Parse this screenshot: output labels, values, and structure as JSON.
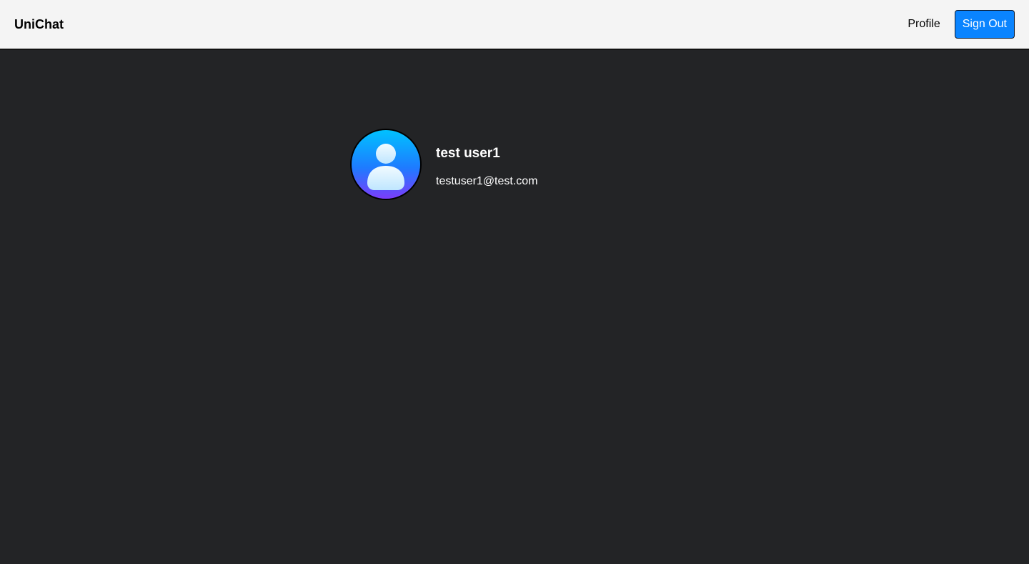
{
  "navbar": {
    "brand": "UniChat",
    "profile_link": "Profile",
    "signout_label": "Sign Out"
  },
  "profile": {
    "name": "test user1",
    "email": "testuser1@test.com",
    "avatar_icon": "user-avatar-icon"
  },
  "colors": {
    "page_background": "#232426",
    "navbar_background": "#f4f4f4",
    "signout_button": "#0a84ff",
    "avatar_gradient_top": "#00c2ff",
    "avatar_gradient_bottom": "#7b3dfb"
  }
}
